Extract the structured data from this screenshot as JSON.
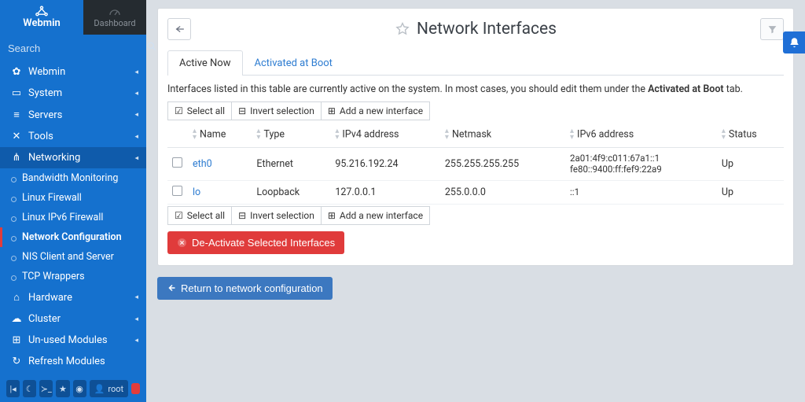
{
  "brand": {
    "name": "Webmin",
    "dashboard": "Dashboard"
  },
  "search": {
    "placeholder": "Search"
  },
  "sidebar": {
    "items": [
      {
        "label": "Webmin",
        "icon": "gear"
      },
      {
        "label": "System",
        "icon": "laptop"
      },
      {
        "label": "Servers",
        "icon": "servers"
      },
      {
        "label": "Tools",
        "icon": "wrench"
      },
      {
        "label": "Networking",
        "icon": "share",
        "open": true
      },
      {
        "label": "Hardware",
        "icon": "hdd"
      },
      {
        "label": "Cluster",
        "icon": "cloud"
      },
      {
        "label": "Un-used Modules",
        "icon": "puzzle"
      },
      {
        "label": "Refresh Modules",
        "icon": "refresh"
      }
    ],
    "sub": [
      {
        "label": "Bandwidth Monitoring"
      },
      {
        "label": "Linux Firewall"
      },
      {
        "label": "Linux IPv6 Firewall"
      },
      {
        "label": "Network Configuration",
        "active": true
      },
      {
        "label": "NIS Client and Server"
      },
      {
        "label": "TCP Wrappers"
      }
    ]
  },
  "bottom": {
    "user": "root"
  },
  "page": {
    "title": "Network Interfaces",
    "tabs": {
      "active": "Active Now",
      "boot": "Activated at Boot"
    },
    "hint_pre": "Interfaces listed in this table are currently active on the system. In most cases, you should edit them under the ",
    "hint_bold": "Activated at Boot",
    "hint_post": " tab.",
    "toolbar": {
      "select_all": "Select all",
      "invert": "Invert selection",
      "add": "Add a new interface"
    },
    "columns": {
      "name": "Name",
      "type": "Type",
      "ipv4": "IPv4 address",
      "netmask": "Netmask",
      "ipv6": "IPv6 address",
      "status": "Status"
    },
    "rows": [
      {
        "name": "eth0",
        "type": "Ethernet",
        "ipv4": "95.216.192.24",
        "netmask": "255.255.255.255",
        "ipv6": "2a01:4f9:c011:67a1::1\nfe80::9400:ff:fef9:22a9",
        "status": "Up"
      },
      {
        "name": "lo",
        "type": "Loopback",
        "ipv4": "127.0.0.1",
        "netmask": "255.0.0.0",
        "ipv6": "::1",
        "status": "Up"
      }
    ],
    "deactivate": "De-Activate Selected Interfaces",
    "return": "Return to network configuration"
  }
}
